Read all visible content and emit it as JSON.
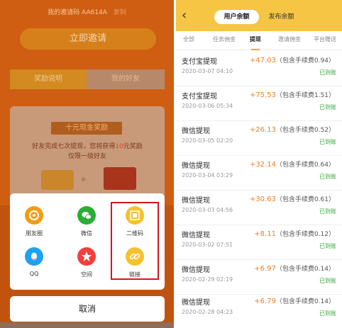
{
  "left": {
    "invite_code_line": "我的邀请码 AA614A",
    "copy_label": "复制",
    "invite_button": "立即邀请",
    "tabs": [
      "奖励说明",
      "我的好友"
    ],
    "reward_title": "十元现金奖励",
    "reward_desc_prefix": "好友完成七次提现，您将获得",
    "reward_desc_amount": "10",
    "reward_desc_suffix": "元奖励",
    "reward_desc_line2": "仅限一级好友",
    "share_items": [
      {
        "label": "朋友圈",
        "icon": "moments-icon",
        "color": "#f39c12"
      },
      {
        "label": "微信",
        "icon": "wechat-icon",
        "color": "#2aae36"
      },
      {
        "label": "二维码",
        "icon": "qrcode-icon",
        "color": "#f5c12f"
      },
      {
        "label": "QQ",
        "icon": "qq-icon",
        "color": "#1da1f2"
      },
      {
        "label": "空间",
        "icon": "qzone-icon",
        "color": "#f2403d"
      },
      {
        "label": "链接",
        "icon": "link-icon",
        "color": "#f5c12f"
      }
    ],
    "cancel": "取消",
    "highlight_color": "#d9141b"
  },
  "right": {
    "back_icon": "back-arrow-icon",
    "segments": [
      "用户余额",
      "发布余额"
    ],
    "filter_tabs": [
      "全部",
      "任务佣金",
      "提现",
      "邀请佣金",
      "平台赠送"
    ],
    "active_filter": "提现",
    "records": [
      {
        "name": "支付宝提现",
        "date": "2020-03-07 04:10",
        "amount": "+47.03",
        "fee": "（包含手续费0.94）",
        "status": "已到账"
      },
      {
        "name": "支付宝提现",
        "date": "2020-03-06 05:34",
        "amount": "+75.53",
        "fee": "（包含手续费1.51）",
        "status": "已到账"
      },
      {
        "name": "微信提现",
        "date": "2020-03-05 02:20",
        "amount": "+26.13",
        "fee": "（包含手续费0.52）",
        "status": "已到账"
      },
      {
        "name": "微信提现",
        "date": "2020-03-04 03:29",
        "amount": "+32.14",
        "fee": "（包含手续费0.64）",
        "status": "已到账"
      },
      {
        "name": "微信提现",
        "date": "2020-03-03 04:56",
        "amount": "+30.63",
        "fee": "（包含手续费0.61）",
        "status": "已到账"
      },
      {
        "name": "微信提现",
        "date": "2020-03-02 07:51",
        "amount": "+8.11",
        "fee": "（包含手续费0.12）",
        "status": "已到账"
      },
      {
        "name": "微信提现",
        "date": "2020-02-29 02:19",
        "amount": "+6.97",
        "fee": "（包含手续费0.14）",
        "status": "已到账"
      },
      {
        "name": "微信提现",
        "date": "2020-02-28 04:23",
        "amount": "+6.79",
        "fee": "（包含手续费0.14）",
        "status": "已到账"
      }
    ]
  }
}
